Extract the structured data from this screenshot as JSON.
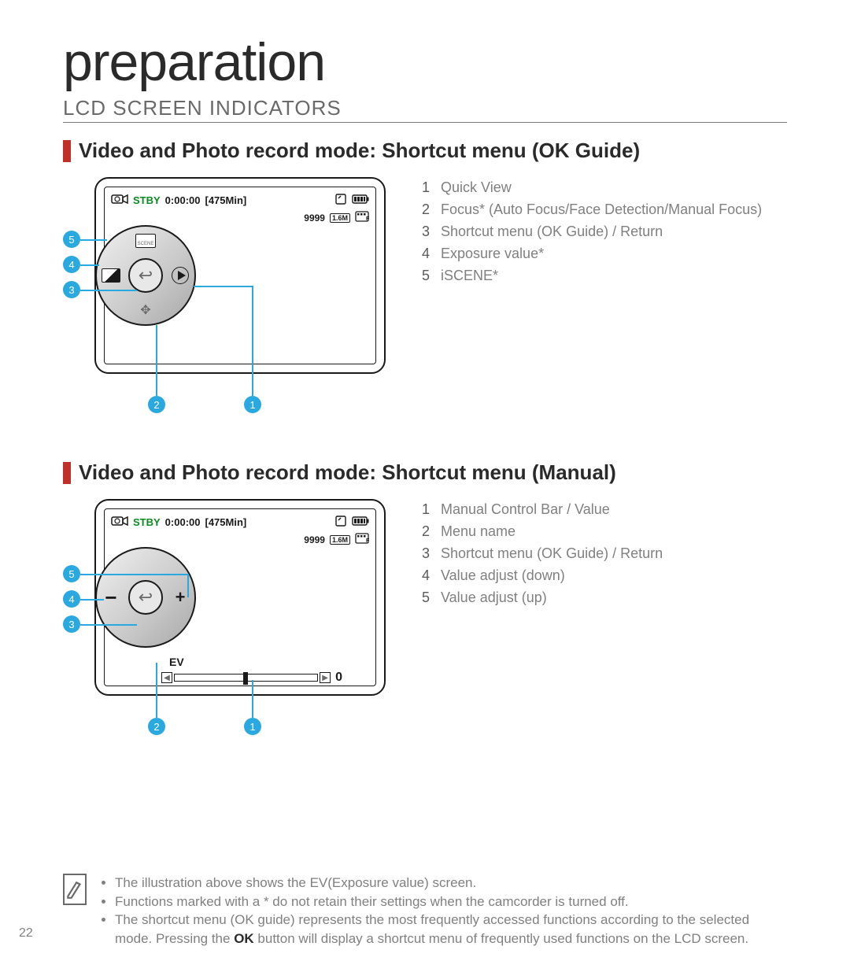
{
  "page": {
    "title": "preparation",
    "subtitle": "LCD SCREEN INDICATORS",
    "number": "22"
  },
  "section1": {
    "heading": "Video and Photo record mode: Shortcut menu (OK Guide)",
    "lcd": {
      "status": "STBY",
      "time": "0:00:00",
      "remaining": "[475Min]",
      "photo_count": "9999",
      "resolution": "1.6M"
    },
    "dial": {
      "top_label": "SCENE"
    },
    "legend": [
      {
        "n": "1",
        "text": "Quick View"
      },
      {
        "n": "2",
        "text": "Focus* (Auto Focus/Face Detection/Manual Focus)"
      },
      {
        "n": "3",
        "text": "Shortcut menu (OK Guide) / Return"
      },
      {
        "n": "4",
        "text": "Exposure value*"
      },
      {
        "n": "5",
        "text": "iSCENE*"
      }
    ]
  },
  "section2": {
    "heading": "Video and Photo record mode: Shortcut menu (Manual)",
    "lcd": {
      "status": "STBY",
      "time": "0:00:00",
      "remaining": "[475Min]",
      "photo_count": "9999",
      "resolution": "1.6M",
      "ev_label": "EV",
      "ev_value": "0"
    },
    "legend": [
      {
        "n": "1",
        "text": "Manual Control Bar / Value"
      },
      {
        "n": "2",
        "text": "Menu name"
      },
      {
        "n": "3",
        "text": "Shortcut menu (OK Guide) / Return"
      },
      {
        "n": "4",
        "text": "Value adjust (down)"
      },
      {
        "n": "5",
        "text": "Value adjust (up)"
      }
    ]
  },
  "footnote": {
    "line1": "The illustration above shows the EV(Exposure value) screen.",
    "line2": "Functions marked with a * do not retain their settings when the camcorder is turned off.",
    "line3_a": "The shortcut menu (OK guide) represents the most frequently accessed functions according to the selected mode. Pressing the ",
    "line3_ok": "OK",
    "line3_b": " button will display a shortcut menu of frequently used functions on the LCD screen."
  }
}
